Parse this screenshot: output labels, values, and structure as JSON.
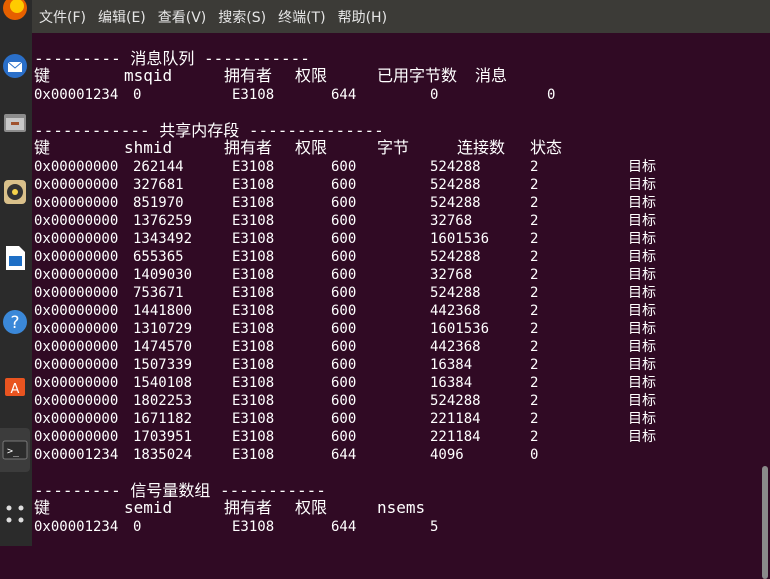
{
  "menubar": {
    "items": [
      "文件(F)",
      "编辑(E)",
      "查看(V)",
      "搜索(S)",
      "终端(T)",
      "帮助(H)"
    ]
  },
  "dock": {
    "icons": [
      "firefox-icon",
      "thunderbird-icon",
      "files-icon",
      "rhythmbox-icon",
      "writer-icon",
      "help-icon",
      "software-center-icon",
      "terminal-icon",
      "show-applications-icon"
    ]
  },
  "terminal": {
    "msgq": {
      "title": "--------- 消息队列 -----------",
      "headers": [
        "键",
        "msqid",
        "拥有者",
        "权限",
        "已用字节数",
        "消息"
      ],
      "rows": [
        [
          "0x00001234",
          "0",
          "E3108",
          "644",
          "0",
          "0"
        ]
      ]
    },
    "shm": {
      "title": "------------ 共享内存段 --------------",
      "headers": [
        "键",
        "shmid",
        "拥有者",
        "权限",
        "字节",
        "连接数",
        "状态"
      ],
      "rows": [
        [
          "0x00000000",
          "262144",
          "E3108",
          "600",
          "524288",
          "2",
          "目标"
        ],
        [
          "0x00000000",
          "327681",
          "E3108",
          "600",
          "524288",
          "2",
          "目标"
        ],
        [
          "0x00000000",
          "851970",
          "E3108",
          "600",
          "524288",
          "2",
          "目标"
        ],
        [
          "0x00000000",
          "1376259",
          "E3108",
          "600",
          "32768",
          "2",
          "目标"
        ],
        [
          "0x00000000",
          "1343492",
          "E3108",
          "600",
          "1601536",
          "2",
          "目标"
        ],
        [
          "0x00000000",
          "655365",
          "E3108",
          "600",
          "524288",
          "2",
          "目标"
        ],
        [
          "0x00000000",
          "1409030",
          "E3108",
          "600",
          "32768",
          "2",
          "目标"
        ],
        [
          "0x00000000",
          "753671",
          "E3108",
          "600",
          "524288",
          "2",
          "目标"
        ],
        [
          "0x00000000",
          "1441800",
          "E3108",
          "600",
          "442368",
          "2",
          "目标"
        ],
        [
          "0x00000000",
          "1310729",
          "E3108",
          "600",
          "1601536",
          "2",
          "目标"
        ],
        [
          "0x00000000",
          "1474570",
          "E3108",
          "600",
          "442368",
          "2",
          "目标"
        ],
        [
          "0x00000000",
          "1507339",
          "E3108",
          "600",
          "16384",
          "2",
          "目标"
        ],
        [
          "0x00000000",
          "1540108",
          "E3108",
          "600",
          "16384",
          "2",
          "目标"
        ],
        [
          "0x00000000",
          "1802253",
          "E3108",
          "600",
          "524288",
          "2",
          "目标"
        ],
        [
          "0x00000000",
          "1671182",
          "E3108",
          "600",
          "221184",
          "2",
          "目标"
        ],
        [
          "0x00000000",
          "1703951",
          "E3108",
          "600",
          "221184",
          "2",
          "目标"
        ],
        [
          "0x00001234",
          "1835024",
          "E3108",
          "644",
          "4096",
          "0",
          ""
        ]
      ]
    },
    "sem": {
      "title": "--------- 信号量数组 -----------",
      "headers": [
        "键",
        "semid",
        "拥有者",
        "权限",
        "nsems"
      ],
      "rows": [
        [
          "0x00001234",
          "0",
          "E3108",
          "644",
          "5"
        ]
      ]
    }
  }
}
